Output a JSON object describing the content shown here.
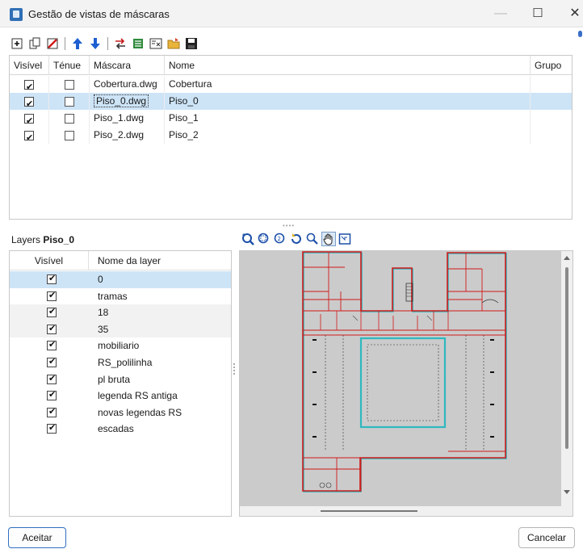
{
  "window": {
    "title": "Gestão de vistas de máscaras"
  },
  "toolbar": {
    "icons": [
      "add-icon",
      "copy-icon",
      "delete-icon",
      "move-up-icon",
      "move-down-icon",
      "replace-icon",
      "import-icon",
      "export-dwg-icon",
      "open-folder-icon",
      "save-icon"
    ]
  },
  "masks": {
    "columns": [
      "Visível",
      "Ténue",
      "Máscara",
      "Nome",
      "Grupo"
    ],
    "rows": [
      {
        "visible": true,
        "tenue": false,
        "mask": "Cobertura.dwg",
        "name": "Cobertura",
        "group": ""
      },
      {
        "visible": true,
        "tenue": false,
        "mask": "Piso_0.dwg",
        "name": "Piso_0",
        "group": "",
        "selected": true
      },
      {
        "visible": true,
        "tenue": false,
        "mask": "Piso_1.dwg",
        "name": "Piso_1",
        "group": ""
      },
      {
        "visible": true,
        "tenue": false,
        "mask": "Piso_2.dwg",
        "name": "Piso_2",
        "group": ""
      }
    ]
  },
  "layers": {
    "label": "Layers",
    "current": "Piso_0",
    "columns": [
      "Visível",
      "Nome da layer"
    ],
    "rows": [
      {
        "visible": true,
        "name": "0",
        "selected": true
      },
      {
        "visible": true,
        "name": "tramas"
      },
      {
        "visible": true,
        "name": "18"
      },
      {
        "visible": true,
        "name": "35"
      },
      {
        "visible": true,
        "name": "mobiliario"
      },
      {
        "visible": true,
        "name": "RS_polilinha"
      },
      {
        "visible": true,
        "name": "pl bruta"
      },
      {
        "visible": true,
        "name": "legenda RS antiga"
      },
      {
        "visible": true,
        "name": "novas legendas RS"
      },
      {
        "visible": true,
        "name": "escadas"
      }
    ]
  },
  "viewer": {
    "tools": [
      "zoom-extents-icon",
      "zoom-window-icon",
      "zoom-previous-icon",
      "regenerate-icon",
      "zoom-icon",
      "pan-hand-icon",
      "select-window-icon"
    ],
    "active_tool": "pan-hand-icon"
  },
  "buttons": {
    "ok": "Aceitar",
    "cancel": "Cancelar"
  },
  "colors": {
    "selection": "#cde4f7",
    "plan_red": "#d11a1a",
    "plan_cyan": "#2fb8c0",
    "viewer_bg": "#cbcbcb"
  }
}
